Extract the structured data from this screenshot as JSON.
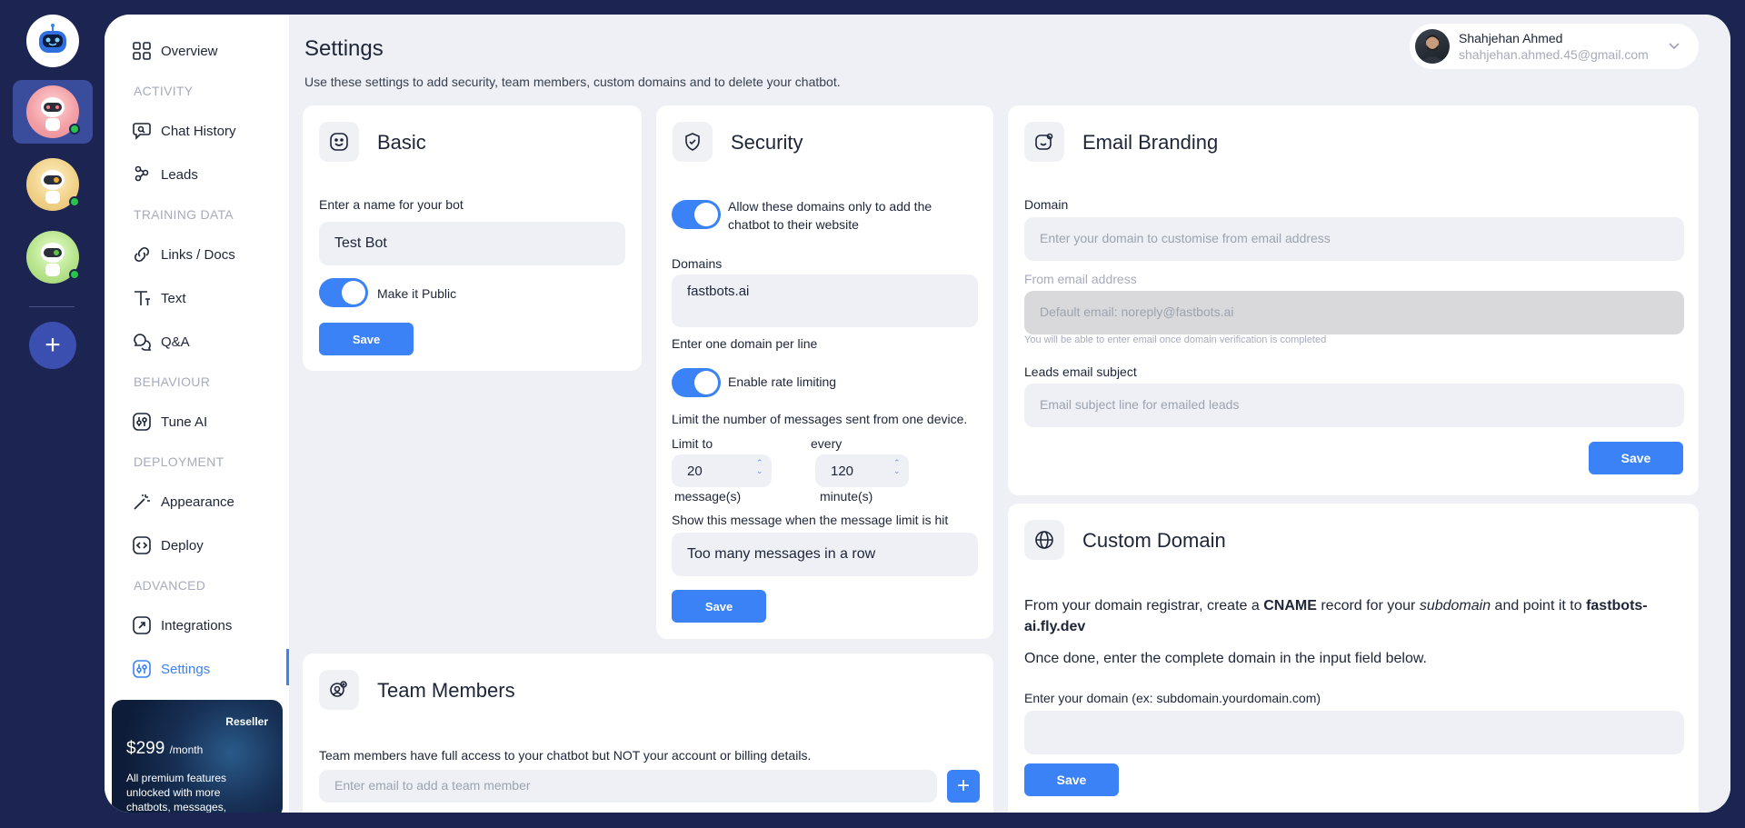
{
  "nav": {
    "overview": "Overview",
    "sec_activity": "ACTIVITY",
    "chat_history": "Chat History",
    "leads": "Leads",
    "sec_training": "TRAINING DATA",
    "links_docs": "Links / Docs",
    "text": "Text",
    "qa": "Q&A",
    "sec_behaviour": "BEHAVIOUR",
    "tune_ai": "Tune AI",
    "sec_deployment": "DEPLOYMENT",
    "appearance": "Appearance",
    "deploy": "Deploy",
    "sec_advanced": "ADVANCED",
    "integrations": "Integrations",
    "settings": "Settings"
  },
  "promo": {
    "tag": "Reseller",
    "price": "$299",
    "period": "/month",
    "desc": "All premium features unlocked with more chatbots, messages, and"
  },
  "header": {
    "title": "Settings",
    "subtitle": "Use these settings to add security, team members, custom domains and to delete your chatbot."
  },
  "user": {
    "name": "Shahjehan Ahmed",
    "email": "shahjehan.ahmed.45@gmail.com"
  },
  "basic": {
    "title": "Basic",
    "name_label": "Enter a name for your bot",
    "name_value": "Test Bot",
    "public_label": "Make it Public",
    "save": "Save"
  },
  "security": {
    "title": "Security",
    "allow_label": "Allow these domains only to add the chatbot to their website",
    "domains_label": "Domains",
    "domains_value": "fastbots.ai",
    "domains_hint": "Enter one domain per line",
    "rate_label": "Enable rate limiting",
    "rate_desc": "Limit the number of messages sent from one device.",
    "limit_to_label": "Limit to",
    "limit_value": "20",
    "messages_unit": "message(s)",
    "every_label": "every",
    "every_value": "120",
    "minutes_unit": "minute(s)",
    "limit_msg_label": "Show this message when the message limit is hit",
    "limit_msg_value": "Too many messages in a row",
    "save": "Save"
  },
  "email_branding": {
    "title": "Email Branding",
    "domain_label": "Domain",
    "domain_placeholder": "Enter your domain to customise from email address",
    "from_label": "From email address",
    "from_placeholder": "Default email: noreply@fastbots.ai",
    "from_hint": "You will be able to enter email once domain verification is completed",
    "subject_label": "Leads email subject",
    "subject_placeholder": "Email subject line for emailed leads",
    "save": "Save"
  },
  "custom_domain": {
    "title": "Custom Domain",
    "p1_a": "From your domain registrar, create a ",
    "p1_b": "CNAME",
    "p1_c": " record for your ",
    "p1_d": "subdomain",
    "p1_e": " and point it to ",
    "p1_f": "fastbots-ai.fly.dev",
    "p2": "Once done, enter the complete domain in the input field below.",
    "input_label": "Enter your domain (ex: subdomain.yourdomain.com)",
    "save": "Save"
  },
  "team": {
    "title": "Team Members",
    "desc": "Team members have full access to your chatbot but NOT your account or billing details.",
    "email_placeholder": "Enter email to add a team member"
  },
  "colors": {
    "accent": "#3b82f6",
    "background": "#1c2452",
    "content_bg": "#eef0f5"
  }
}
